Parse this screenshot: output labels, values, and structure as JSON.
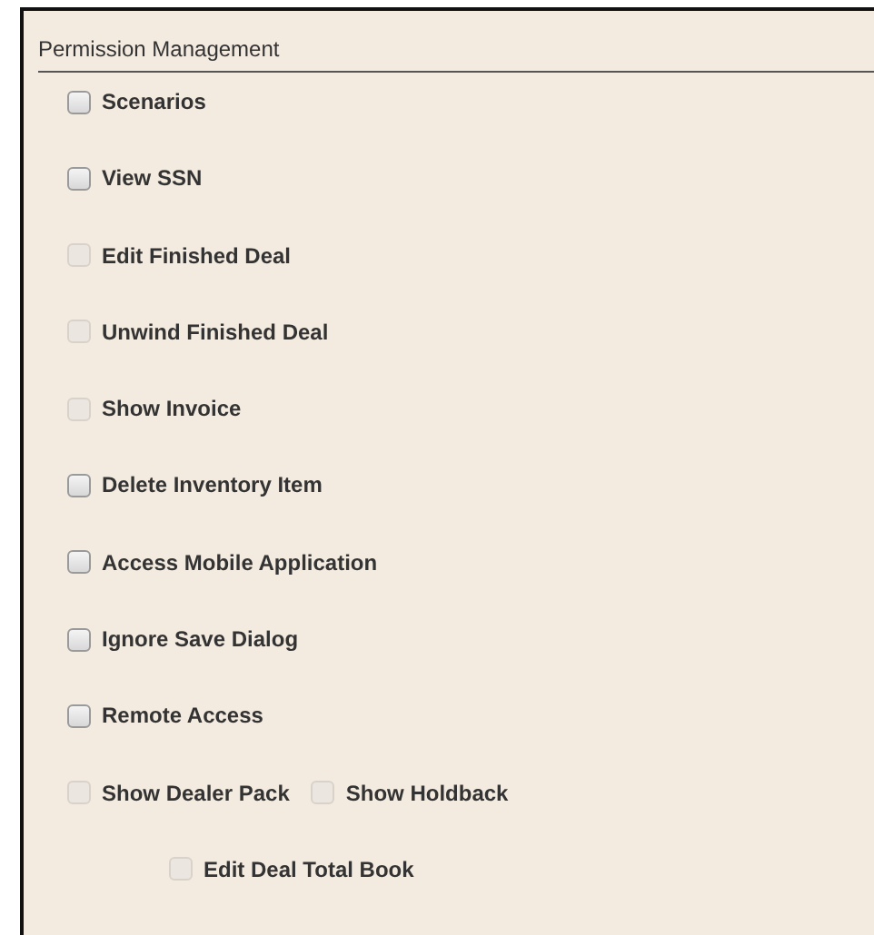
{
  "panel": {
    "title": "Permission Management"
  },
  "rows": [
    {
      "items": [
        {
          "label": "Scenarios",
          "checked": false,
          "disabled": false
        }
      ]
    },
    {
      "items": [
        {
          "label": "View SSN",
          "checked": false,
          "disabled": false
        }
      ]
    },
    {
      "items": [
        {
          "label": "Edit Finished Deal",
          "checked": false,
          "disabled": true
        }
      ]
    },
    {
      "items": [
        {
          "label": "Unwind Finished Deal",
          "checked": false,
          "disabled": true
        }
      ]
    },
    {
      "items": [
        {
          "label": "Show Invoice",
          "checked": false,
          "disabled": true
        }
      ]
    },
    {
      "items": [
        {
          "label": "Delete Inventory Item",
          "checked": false,
          "disabled": false
        }
      ]
    },
    {
      "items": [
        {
          "label": "Access Mobile Application",
          "checked": false,
          "disabled": false
        }
      ]
    },
    {
      "items": [
        {
          "label": "Ignore Save Dialog",
          "checked": false,
          "disabled": false
        }
      ]
    },
    {
      "items": [
        {
          "label": "Remote Access",
          "checked": false,
          "disabled": false
        }
      ]
    },
    {
      "items": [
        {
          "label": "Show Dealer Pack",
          "checked": false,
          "disabled": true
        },
        {
          "label": "Show Holdback",
          "checked": false,
          "disabled": true
        }
      ],
      "children": [
        {
          "items": [
            {
              "label": "Edit Deal Total Book",
              "checked": false,
              "disabled": true
            }
          ]
        }
      ]
    }
  ]
}
